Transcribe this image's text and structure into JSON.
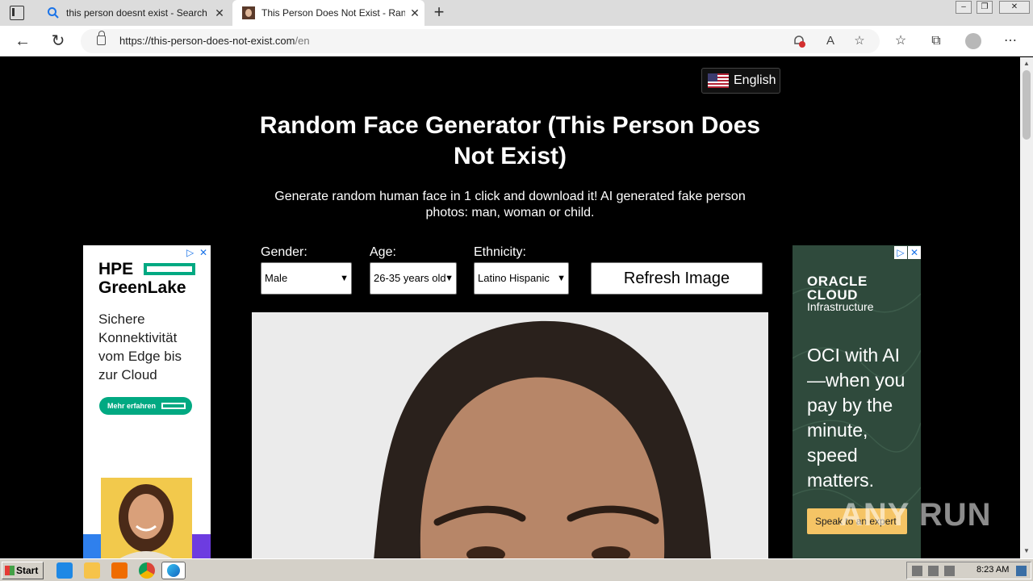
{
  "browser": {
    "tabs": [
      {
        "title": "this person doesnt exist - Search",
        "close": "✕",
        "active": false
      },
      {
        "title": "This Person Does Not Exist - Random Face Generator",
        "close": "✕",
        "active": true
      }
    ],
    "new_tab": "+",
    "window_controls": {
      "minimize": "‒",
      "restore": "❐",
      "close": "✕"
    },
    "address": {
      "host": "https://this-person-does-not-exist.com",
      "path": "/en"
    },
    "nav": {
      "back": "←",
      "reload": "↻"
    },
    "toolbar_icons": {
      "alert": "🔔",
      "read_aloud": "A",
      "add_favorite": "☆",
      "favorites": "☆",
      "collections": "⧉",
      "more": "⋯"
    }
  },
  "page": {
    "language_button": "English",
    "title": "Random Face Generator (This Person Does Not Exist)",
    "subtitle": "Generate random human face in 1 click and download it! AI generated fake person photos: man, woman or child.",
    "controls": {
      "gender": {
        "label": "Gender:",
        "value": "Male"
      },
      "age": {
        "label": "Age:",
        "value": "26-35 years old"
      },
      "ethnicity": {
        "label": "Ethnicity:",
        "value": "Latino Hispanic"
      },
      "refresh": "Refresh Image"
    }
  },
  "ads": {
    "left": {
      "logo_line1": "HPE",
      "logo_line2": "GreenLake",
      "text": "Sichere Konnektivität vom Edge bis zur Cloud",
      "cta": "Mehr erfahren",
      "adchoice": "▷",
      "close": "✕"
    },
    "right": {
      "logo_line1": "ORACLE",
      "logo_line2": "CLOUD",
      "logo_sub": "Infrastructure",
      "text": "OCI with AI —when you pay by the minute, speed matters.",
      "cta": "Speak to an expert",
      "adchoice": "▷",
      "close": "✕"
    }
  },
  "watermark": "ANY RUN",
  "taskbar": {
    "start": "Start",
    "clock": "8:23 AM"
  }
}
